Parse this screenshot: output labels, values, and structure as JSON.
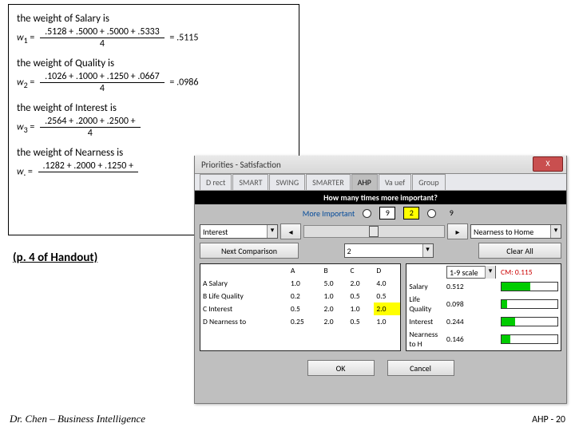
{
  "formulas": {
    "t1": "the weight of Salary is",
    "n1": ".5128 + .5000 + .5000 + .5333",
    "d1": "4",
    "r1": ".5115",
    "t2": "the weight of Quality is",
    "n2": ".1026 + .1000 + .1250 + .0667",
    "d2": "4",
    "r2": ".0986",
    "t3": "the weight of Interest is",
    "n3": ".2564 + .2000 + .2500 +",
    "d3": "4",
    "r3": "",
    "t4": "the weight of Nearness is",
    "n4": ".1282 + .2000 + .1250 +",
    "d4": "",
    "r4": ""
  },
  "handout": "(p. 4 of Handout)",
  "footerL": "Dr. Chen – Business Intelligence",
  "footerR": "AHP - 20",
  "dlg": {
    "title": "Priorities - Satisfaction",
    "tabs": [
      "D rect",
      "SMART",
      "SWING",
      "SMARTER",
      "AHP",
      "Va uef",
      "Group"
    ],
    "activeTab": 4,
    "question": "How many times more important?",
    "moreImportant": "More Important",
    "nine": "9",
    "two": "2",
    "leftCrit": "Interest",
    "rightCrit": "Nearness to Home",
    "nextComparison": "Next Comparison",
    "compVal": "2",
    "clearAll": "Clear All",
    "cols": [
      "A",
      "B",
      "C",
      "D"
    ],
    "scaleLabel": "1-9 scale",
    "cm": "CM: 0.115",
    "rows": [
      {
        "name": "A Salary",
        "v": [
          "1.0",
          "5.0",
          "2.0",
          "4.0"
        ]
      },
      {
        "name": "B Life Quality",
        "v": [
          "0.2",
          "1.0",
          "0.5",
          "0.5"
        ]
      },
      {
        "name": "C Interest",
        "v": [
          "0.5",
          "2.0",
          "1.0",
          "2.0"
        ]
      },
      {
        "name": "D Nearness to",
        "v": [
          "0.25",
          "2.0",
          "0.5",
          "1.0"
        ]
      }
    ],
    "hl": {
      "r": 2,
      "c": 3
    },
    "pri": [
      {
        "name": "Salary",
        "v": "0.512",
        "bar": 51
      },
      {
        "name": "Life Quality",
        "v": "0.098",
        "bar": 10
      },
      {
        "name": "Interest",
        "v": "0.244",
        "bar": 24
      },
      {
        "name": "Nearness to H",
        "v": "0.146",
        "bar": 15
      }
    ],
    "ok": "OK",
    "cancel": "Cancel"
  }
}
